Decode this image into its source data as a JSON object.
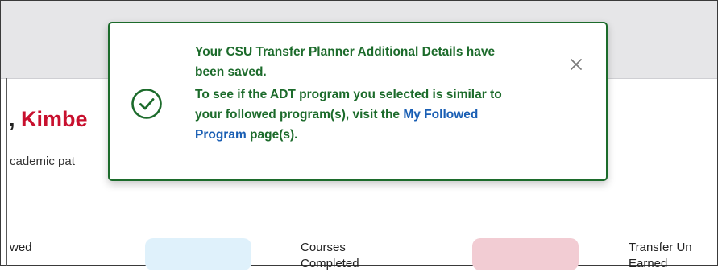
{
  "background": {
    "greeting_prefix": ", ",
    "greeting_name": "Kimbe",
    "subtext": "cademic pat",
    "stats": [
      {
        "line1": "wed",
        "line2": ""
      },
      {
        "line1": "Courses",
        "line2": "Completed"
      },
      {
        "line1": "Transfer Un",
        "line2": "Earned"
      }
    ]
  },
  "toast": {
    "message_saved": "Your CSU Transfer Planner Additional Details have been saved.",
    "info_before_link": "To see if the ADT program you selected is similar to your followed program(s), visit the ",
    "link_text": "My Followed Program",
    "info_after_link": " page(s).",
    "close_symbol": "×"
  },
  "colors": {
    "success_green": "#1c6b2b",
    "link_blue": "#1a5fb4",
    "name_red": "#c8102e"
  },
  "icons": {
    "status": "check-circle-icon",
    "close": "close-icon"
  }
}
